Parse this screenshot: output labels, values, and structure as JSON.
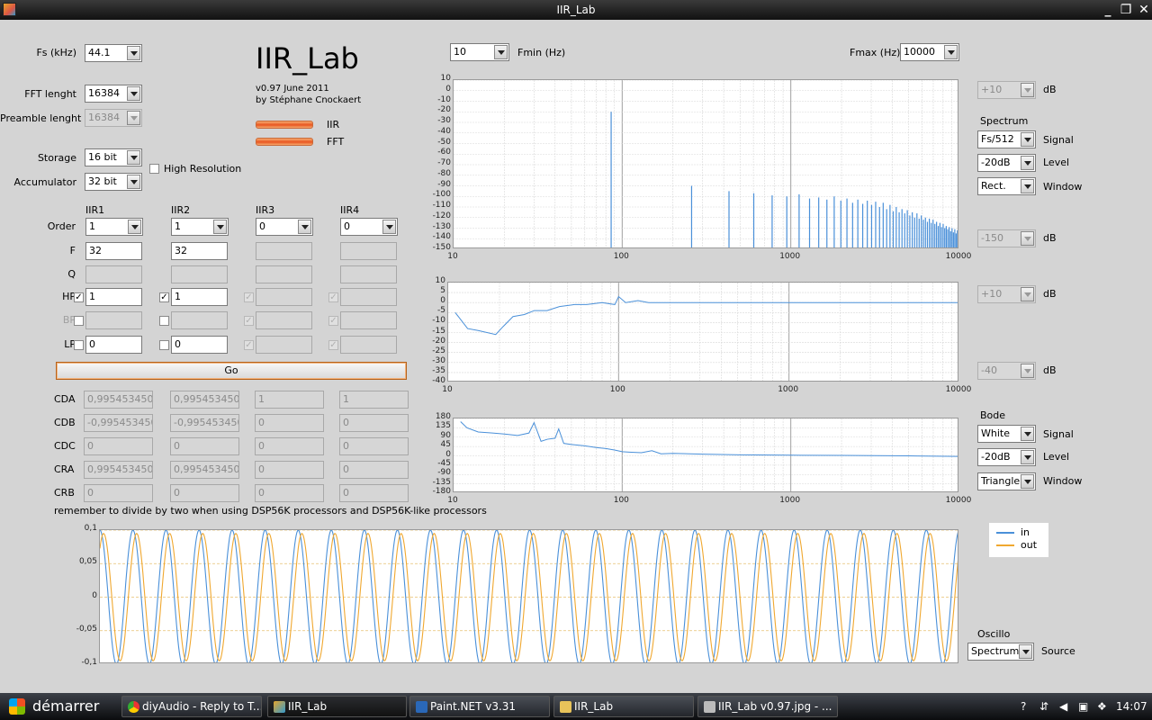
{
  "window": {
    "title": "IIR_Lab"
  },
  "app": {
    "title": "IIR_Lab",
    "version": "v0.97 June 2011",
    "author": "by Stéphane Cnockaert",
    "led_iir": "IIR",
    "led_fft": "FFT"
  },
  "settings": {
    "fs_label": "Fs (kHz)",
    "fs_value": "44.1",
    "fft_label": "FFT lenght",
    "fft_value": "16384",
    "preamble_label": "Preamble lenght",
    "preamble_value": "16384",
    "storage_label": "Storage",
    "storage_value": "16 bit",
    "accumulator_label": "Accumulator",
    "accumulator_value": "32 bit",
    "highres_label": "High Resolution"
  },
  "filters": {
    "headers": [
      "IIR1",
      "IIR2",
      "IIR3",
      "IIR4"
    ],
    "row_labels": {
      "order": "Order",
      "f": "F",
      "q": "Q",
      "hp": "HP",
      "bp": "BP",
      "lp": "LP"
    },
    "order": [
      "1",
      "1",
      "0",
      "0"
    ],
    "f": [
      "32",
      "32",
      "",
      ""
    ],
    "q": [
      "",
      "",
      "",
      ""
    ],
    "hp": [
      "1",
      "1",
      "",
      ""
    ],
    "bp": [
      "",
      "",
      "",
      ""
    ],
    "lp": [
      "0",
      "0",
      "",
      ""
    ]
  },
  "go_label": "Go",
  "coeffs": {
    "labels": [
      "CDA",
      "CDB",
      "CDC",
      "CRA",
      "CRB"
    ],
    "rows": [
      [
        "0,9954534508",
        "0,9954534508",
        "1",
        "1"
      ],
      [
        "-0,995453450",
        "-0,995453450",
        "0",
        "0"
      ],
      [
        "0",
        "0",
        "0",
        "0"
      ],
      [
        "0,9954534508",
        "0,9954534508",
        "0",
        "0"
      ],
      [
        "0",
        "0",
        "0",
        "0"
      ]
    ]
  },
  "note": "remember to divide by two when using DSP56K processors and DSP56K-like processors",
  "freq": {
    "fmin_label": "Fmin (Hz)",
    "fmin_value": "10",
    "fmax_label": "Fmax (Hz)",
    "fmax_value": "10000"
  },
  "right": {
    "db": "dB",
    "spec_top": "+10",
    "spec_bottom": "-150",
    "mag_top": "+10",
    "mag_bottom": "-40",
    "spectrum_label": "Spectrum",
    "spectrum_signal": "Fs/512",
    "spectrum_level": "-20dB",
    "spectrum_window": "Rect.",
    "bode_label": "Bode",
    "bode_signal": "White",
    "bode_level": "-20dB",
    "bode_window": "Triangle",
    "signal_label": "Signal",
    "level_label": "Level",
    "window_label": "Window",
    "oscillo_label": "Oscillo",
    "oscillo_source": "Spectrum",
    "source_label": "Source"
  },
  "legend": {
    "in": "in",
    "out": "out"
  },
  "colors": {
    "in": "#4a90d9",
    "out": "#f0a830",
    "grid": "#d8d8d8",
    "decade": "#a0a0a0"
  },
  "chart_data": [
    {
      "type": "bar",
      "ylim": [
        -150,
        10
      ],
      "xlim": [
        10,
        10000
      ],
      "xscale": "log",
      "yticks": [
        "10",
        "0",
        "-10",
        "-20",
        "-30",
        "-40",
        "-50",
        "-60",
        "-70",
        "-80",
        "-90",
        "-100",
        "-110",
        "-120",
        "-130",
        "-140",
        "-150"
      ],
      "xticks": [
        "10",
        "100",
        "1000",
        "10000"
      ],
      "x": [
        86,
        258,
        430,
        603,
        775,
        947,
        1120,
        1292,
        1464,
        1637,
        1809,
        1981,
        2153,
        2326,
        2498,
        2670,
        2843,
        3015,
        3187,
        3360,
        3532,
        3704,
        3876,
        4049,
        4221,
        4393,
        4566,
        4738,
        4910,
        5082,
        5255,
        5427,
        5599,
        5772,
        5944,
        6116,
        6289,
        6461,
        6633,
        6805,
        6978,
        7150,
        7322,
        7495,
        7667,
        7839,
        8011,
        8184,
        8356,
        8528,
        8701,
        8873,
        9045,
        9218,
        9390,
        9562,
        9734,
        9907
      ],
      "values": [
        -20,
        -90,
        -95,
        -97,
        -99,
        -100,
        -98,
        -102,
        -101,
        -103,
        -100,
        -104,
        -102,
        -106,
        -103,
        -107,
        -104,
        -108,
        -105,
        -110,
        -106,
        -112,
        -108,
        -114,
        -110,
        -115,
        -112,
        -116,
        -113,
        -118,
        -115,
        -120,
        -116,
        -121,
        -118,
        -122,
        -120,
        -124,
        -121,
        -125,
        -122,
        -126,
        -124,
        -128,
        -125,
        -129,
        -126,
        -130,
        -128,
        -131,
        -129,
        -133,
        -130,
        -134,
        -131,
        -135,
        -132,
        -136
      ]
    },
    {
      "type": "line",
      "ylim": [
        -40,
        10
      ],
      "xlim": [
        10,
        10000
      ],
      "xscale": "log",
      "yticks": [
        "10",
        "5",
        "0",
        "-5",
        "-10",
        "-15",
        "-20",
        "-25",
        "-30",
        "-35",
        "-40"
      ],
      "xticks": [
        "10",
        "100",
        "1000",
        "10000"
      ],
      "x": [
        11,
        13,
        15,
        19,
        21,
        24,
        28,
        32,
        38,
        45,
        55,
        65,
        80,
        95,
        100,
        110,
        130,
        150,
        200,
        300,
        500,
        1000,
        2000,
        5000,
        10000
      ],
      "values": [
        -5,
        -13,
        -14,
        -16,
        -12,
        -7,
        -6,
        -4,
        -4,
        -2,
        -1,
        -1,
        0,
        -1,
        3,
        0,
        1,
        0,
        0,
        0,
        0,
        0,
        0,
        0,
        0
      ]
    },
    {
      "type": "line",
      "ylim": [
        -180,
        180
      ],
      "xlim": [
        10,
        10000
      ],
      "xscale": "log",
      "yticks": [
        "180",
        "135",
        "90",
        "45",
        "0",
        "-45",
        "-90",
        "-135",
        "-180"
      ],
      "xticks": [
        "10",
        "100",
        "1000",
        "10000"
      ],
      "x": [
        11,
        12,
        14,
        17,
        20,
        24,
        28,
        30,
        33,
        36,
        40,
        42,
        45,
        50,
        60,
        70,
        80,
        90,
        100,
        110,
        130,
        150,
        170,
        200,
        300,
        500,
        1000,
        2000,
        5000,
        10000
      ],
      "values": [
        165,
        135,
        115,
        110,
        105,
        98,
        110,
        160,
        70,
        80,
        85,
        130,
        60,
        55,
        48,
        40,
        35,
        28,
        20,
        18,
        15,
        25,
        10,
        12,
        8,
        5,
        3,
        2,
        0,
        -3
      ]
    },
    {
      "type": "line",
      "ylim": [
        -0.1,
        0.1
      ],
      "yticks": [
        "0,1",
        "0,05",
        "0",
        "-0,05",
        "-0,1"
      ],
      "series": [
        {
          "name": "in",
          "amplitude": 0.1,
          "cycles": 26
        },
        {
          "name": "out",
          "amplitude": 0.095,
          "cycles": 26
        }
      ]
    }
  ],
  "taskbar": {
    "start": "démarrer",
    "items": [
      "diyAudio - Reply to T...",
      "IIR_Lab",
      "Paint.NET v3.31",
      "IIR_Lab",
      "IIR_Lab v0.97.jpg - ..."
    ],
    "clock": "14:07"
  }
}
